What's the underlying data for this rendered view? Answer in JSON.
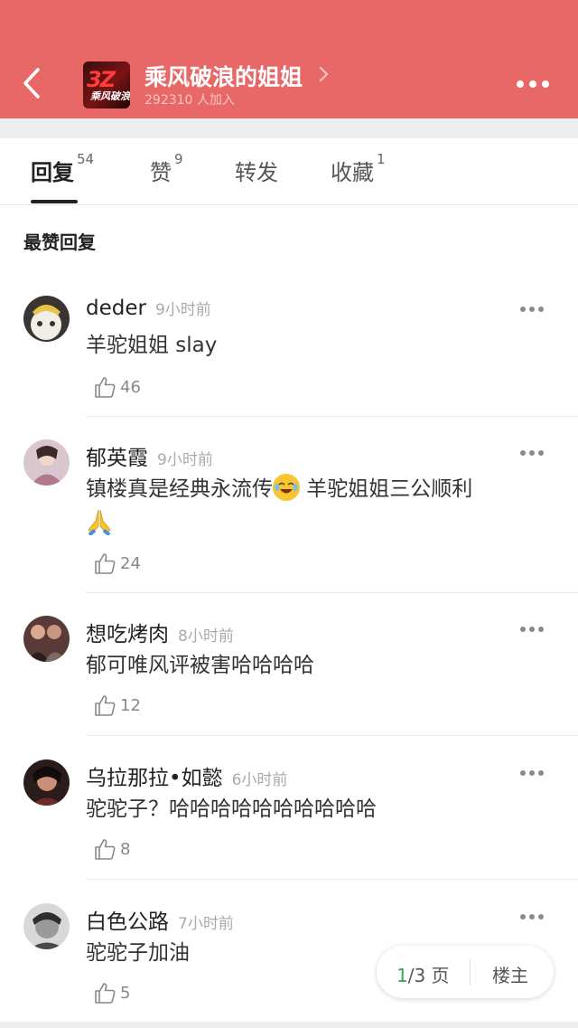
{
  "header": {
    "group_title": "乘风破浪的姐姐",
    "members_text": "292310 人加入",
    "avatar_mark": "3Z",
    "avatar_sub": "乘风破浪"
  },
  "tabs": [
    {
      "label": "回复",
      "count": "54",
      "active": true
    },
    {
      "label": "赞",
      "count": "9"
    },
    {
      "label": "转发",
      "count": ""
    },
    {
      "label": "收藏",
      "count": "1"
    }
  ],
  "section_title": "最赞回复",
  "comments": [
    {
      "username": "deder",
      "time": "9小时前",
      "text": "羊驼姐姐 slay",
      "likes": "46"
    },
    {
      "username": "郁英霞",
      "time": "9小时前",
      "text_a": "镇楼真是经典永流传",
      "text_b": " 羊驼姐姐三公顺利",
      "likes": "24"
    },
    {
      "username": "想吃烤肉",
      "time": "8小时前",
      "text": "郁可唯风评被害哈哈哈哈",
      "likes": "12"
    },
    {
      "username": "乌拉那拉•如懿",
      "time": "6小时前",
      "text": "驼驼子？哈哈哈哈哈哈哈哈哈哈",
      "likes": "8"
    },
    {
      "username": "白色公路",
      "time": "7小时前",
      "text": "驼驼子加油",
      "likes": "5"
    }
  ],
  "pager": {
    "current": "1",
    "total_text": "/3 页",
    "owner_label": "楼主"
  },
  "colors": {
    "header_bg": "#e86868",
    "accent_green": "#2fa84f"
  }
}
